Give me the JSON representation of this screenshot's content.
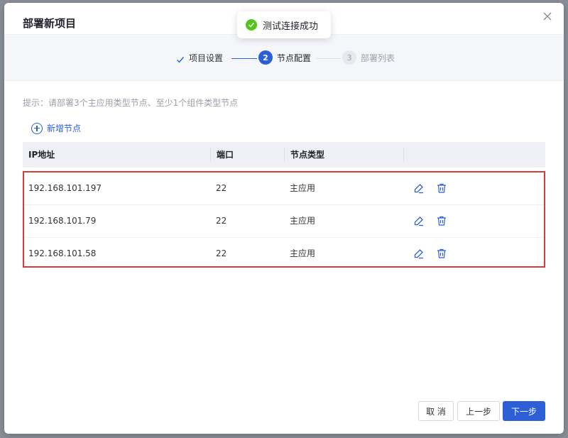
{
  "dialog": {
    "title": "部署新项目"
  },
  "steps": [
    {
      "num": "",
      "label": "项目设置",
      "state": "done"
    },
    {
      "num": "2",
      "label": "节点配置",
      "state": "active"
    },
    {
      "num": "3",
      "label": "部署列表",
      "state": "pending"
    }
  ],
  "toast": {
    "message": "测试连接成功",
    "icon": "check-circle-icon"
  },
  "hint": "提示：请部署3个主应用类型节点、至少1个组件类型节点",
  "add_node_label": "新增节点",
  "table": {
    "columns": [
      "IP地址",
      "端口",
      "节点类型",
      ""
    ],
    "rows": [
      {
        "ip": "192.168.101.197",
        "port": "22",
        "type": "主应用"
      },
      {
        "ip": "192.168.101.79",
        "port": "22",
        "type": "主应用"
      },
      {
        "ip": "192.168.101.58",
        "port": "22",
        "type": "主应用"
      }
    ],
    "row_actions": [
      "edit-icon",
      "delete-icon"
    ]
  },
  "footer": {
    "cancel": "取 消",
    "prev": "上一步",
    "next": "下一步"
  },
  "colors": {
    "primary": "#2c5fd6",
    "success": "#52c41a",
    "highlight_border": "#d93a3a",
    "step_pending": "#c8ccd4"
  }
}
